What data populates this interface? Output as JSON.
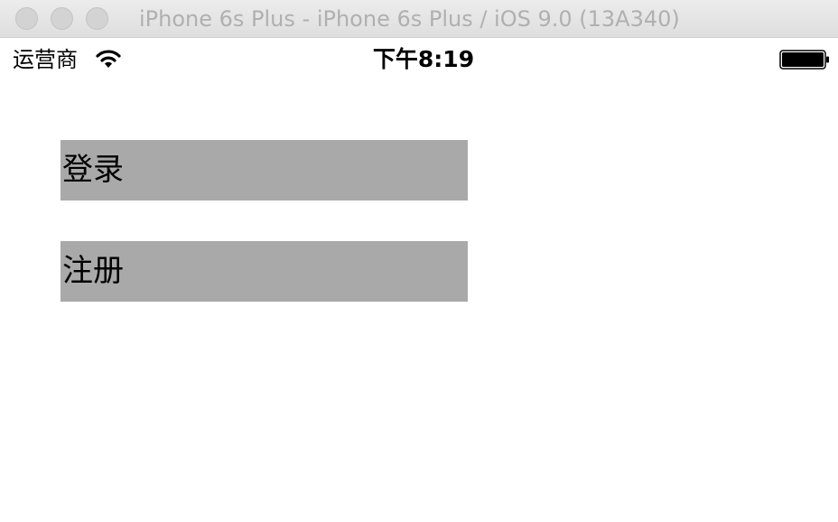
{
  "window": {
    "title": "iPhone 6s Plus - iPhone 6s Plus / iOS 9.0 (13A340)"
  },
  "status_bar": {
    "carrier": "运营商",
    "time": "下午8:19",
    "icons": [
      "wifi-icon",
      "battery-icon"
    ]
  },
  "buttons": {
    "login_label": "登录",
    "register_label": "注册"
  },
  "colors": {
    "button_background": "#a9a9a9",
    "background": "#ffffff",
    "title_text": "#b0b0b0"
  }
}
